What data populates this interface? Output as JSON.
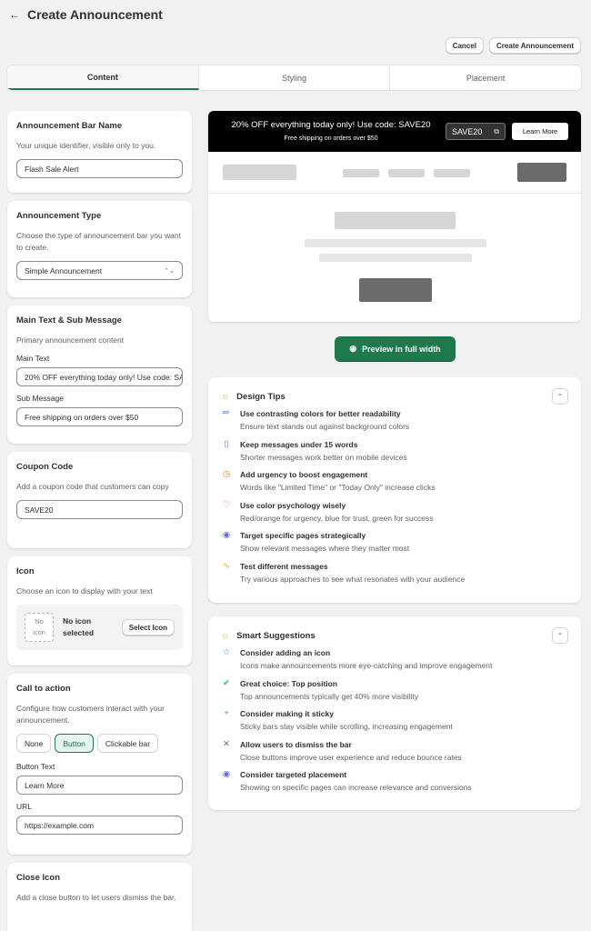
{
  "header": {
    "title": "Create Announcement"
  },
  "actions": {
    "cancel": "Cancel",
    "create": "Create Announcement"
  },
  "tabs": [
    {
      "label": "Content",
      "active": true
    },
    {
      "label": "Styling",
      "active": false
    },
    {
      "label": "Placement",
      "active": false
    }
  ],
  "bar_name": {
    "title": "Announcement Bar Name",
    "desc": "Your unique identifier, visible only to you.",
    "value": "Flash Sale Alert"
  },
  "ann_type": {
    "title": "Announcement Type",
    "desc": "Choose the type of announcement bar you want to create.",
    "value": "Simple Announcement"
  },
  "main_text": {
    "title": "Main Text & Sub Message",
    "desc": "Primary announcement content",
    "main_label": "Main Text",
    "main_value": "20% OFF everything today only! Use code: SAVE20",
    "sub_label": "Sub Message",
    "sub_value": "Free shipping on orders over $50"
  },
  "coupon": {
    "title": "Coupon Code",
    "desc": "Add a coupon code that customers can copy",
    "value": "SAVE20"
  },
  "icon": {
    "title": "Icon",
    "desc": "Choose an icon to display with your text",
    "placeholder_line1": "No",
    "placeholder_line2": "icon",
    "status_line1": "No icon",
    "status_line2": "selected",
    "button": "Select Icon"
  },
  "cta": {
    "title": "Call to action",
    "desc": "Configure how customers interact with your announcement.",
    "options": [
      "None",
      "Button",
      "Clickable bar"
    ],
    "selected": "Button",
    "button_text_label": "Button Text",
    "button_text_value": "Learn More",
    "url_label": "URL",
    "url_value": "https://example.com"
  },
  "close_icon": {
    "title": "Close Icon",
    "desc": "Add a close button to let users dismiss the bar."
  },
  "preview": {
    "main": "20% OFF everything today only! Use code: SAVE20",
    "sub": "Free shipping on orders over $50",
    "coupon": "SAVE20",
    "button": "Learn More",
    "full_width_button": "Preview in full width"
  },
  "design_tips": {
    "title": "Design Tips",
    "items": [
      {
        "icon": "pencil-icon",
        "color": "#3b82f6",
        "title": "Use contrasting colors for better readability",
        "desc": "Ensure text stands out against background colors"
      },
      {
        "icon": "mobile-icon",
        "color": "#8b5cf6",
        "title": "Keep messages under 15 words",
        "desc": "Shorter messages work better on mobile devices"
      },
      {
        "icon": "clock-icon",
        "color": "#f97316",
        "title": "Add urgency to boost engagement",
        "desc": "Words like \"Limited Time\" or \"Today Only\" increase clicks"
      },
      {
        "icon": "heart-icon",
        "color": "#ec4899",
        "title": "Use color psychology wisely",
        "desc": "Red/orange for urgency, blue for trust, green for success"
      },
      {
        "icon": "location-pin-icon",
        "color": "#6366f1",
        "title": "Target specific pages strategically",
        "desc": "Show relevant messages where they matter most"
      },
      {
        "icon": "activity-icon",
        "color": "#eab308",
        "title": "Test different messages",
        "desc": "Try various approaches to see what resonates with your audience"
      }
    ]
  },
  "smart_suggestions": {
    "title": "Smart Suggestions",
    "items": [
      {
        "icon": "star-icon",
        "color": "#3b82f6",
        "title": "Consider adding an icon",
        "desc": "Icons make announcements more eye-catching and improve engagement"
      },
      {
        "icon": "check-circle-icon",
        "color": "#22c55e",
        "title": "Great choice: Top position",
        "desc": "Top announcements typically get 40% more visibility"
      },
      {
        "icon": "plus-icon",
        "color": "#0ea5e9",
        "title": "Consider making it sticky",
        "desc": "Sticky bars stay visible while scrolling, increasing engagement"
      },
      {
        "icon": "x-icon",
        "color": "#64748b",
        "title": "Allow users to dismiss the bar",
        "desc": "Close buttons improve user experience and reduce bounce rates"
      },
      {
        "icon": "location-pin-icon",
        "color": "#6366f1",
        "title": "Consider targeted placement",
        "desc": "Showing on specific pages can increase relevance and conversions"
      }
    ]
  }
}
